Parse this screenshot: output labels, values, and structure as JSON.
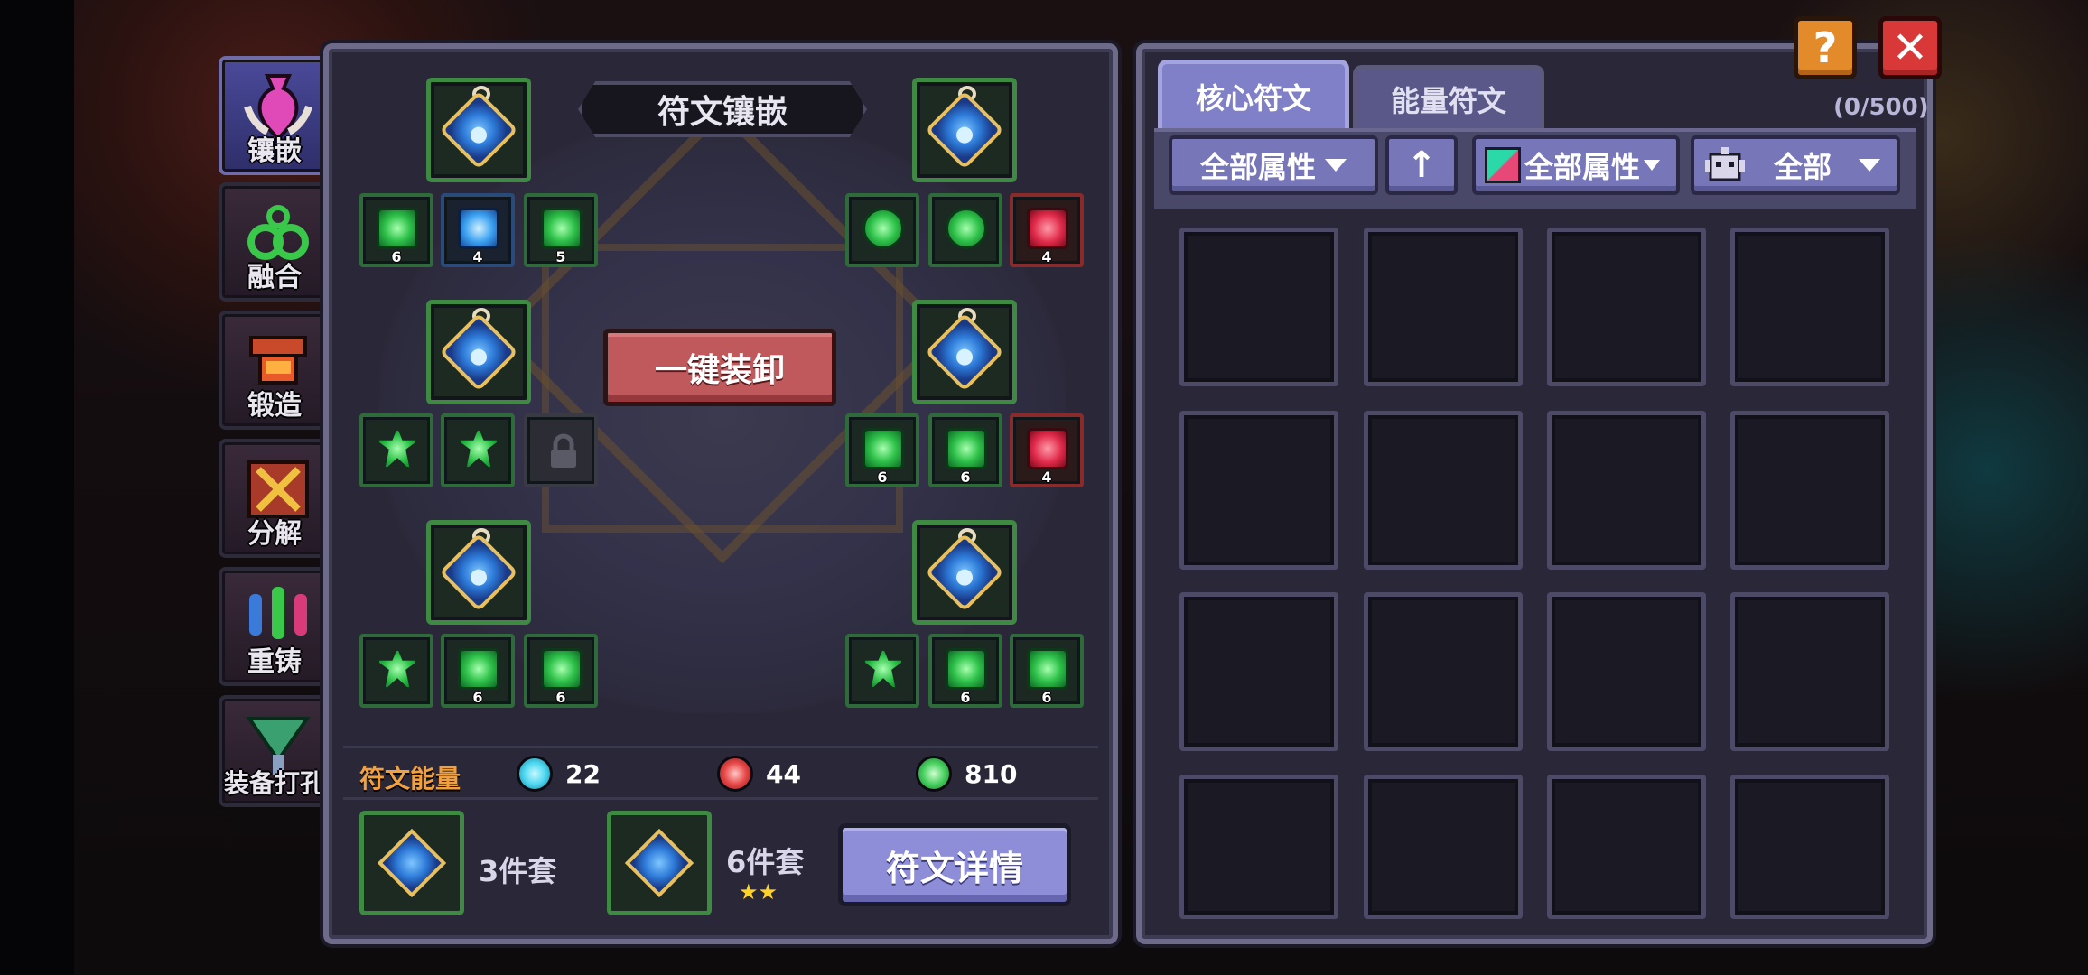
{
  "nav": {
    "items": [
      {
        "label": "镶嵌",
        "icon": "vase-icon",
        "active": true
      },
      {
        "label": "融合",
        "icon": "fusion-icon",
        "active": false
      },
      {
        "label": "锻造",
        "icon": "anvil-icon",
        "active": false
      },
      {
        "label": "分解",
        "icon": "decompose-icon",
        "active": false
      },
      {
        "label": "重铸",
        "icon": "recast-icon",
        "active": false
      },
      {
        "label": "装备打孔",
        "icon": "socket-drill-icon",
        "active": false
      }
    ]
  },
  "inlay": {
    "title": "符文镶嵌",
    "unequip_label": "一键装卸",
    "groups": [
      {
        "side": "left",
        "slots": [
          {
            "level": "6",
            "color": "green"
          },
          {
            "level": "4",
            "color": "blue"
          },
          {
            "level": "5",
            "color": "green"
          }
        ]
      },
      {
        "side": "right",
        "slots": [
          {
            "level": "",
            "color": "green"
          },
          {
            "level": "",
            "color": "green"
          },
          {
            "level": "4",
            "color": "red"
          }
        ]
      },
      {
        "side": "left",
        "slots": [
          {
            "level": "",
            "color": "green"
          },
          {
            "level": "",
            "color": "green"
          },
          {
            "level": "",
            "color": "locked"
          }
        ]
      },
      {
        "side": "right",
        "slots": [
          {
            "level": "6",
            "color": "green"
          },
          {
            "level": "6",
            "color": "green"
          },
          {
            "level": "4",
            "color": "red"
          }
        ]
      },
      {
        "side": "left",
        "slots": [
          {
            "level": "",
            "color": "green"
          },
          {
            "level": "6",
            "color": "green"
          },
          {
            "level": "6",
            "color": "green"
          }
        ]
      },
      {
        "side": "right",
        "slots": [
          {
            "level": "",
            "color": "green"
          },
          {
            "level": "6",
            "color": "green"
          },
          {
            "level": "6",
            "color": "green"
          }
        ]
      }
    ]
  },
  "energy": {
    "label": "符文能量",
    "items": [
      {
        "icon": "blue-diamond-icon",
        "value": "22",
        "color": "#4cd8f0"
      },
      {
        "icon": "red-flame-icon",
        "value": "44",
        "color": "#e84848"
      },
      {
        "icon": "green-orb-icon",
        "value": "810",
        "color": "#48d060"
      }
    ]
  },
  "sets": [
    {
      "label": "3件套",
      "stars": ""
    },
    {
      "label": "6件套",
      "stars": "★★"
    }
  ],
  "detail_button": "符文详情",
  "tabs": [
    {
      "label": "核心符文",
      "active": true
    },
    {
      "label": "能量符文",
      "active": false
    }
  ],
  "inventory_count": "(0/500)",
  "filters": {
    "attribute": "全部属性",
    "sort": "↑",
    "color_attribute": "全部属性",
    "type": "全部"
  },
  "buttons": {
    "help": "?",
    "close": "✕"
  },
  "colors": {
    "accent": "#8080c8",
    "unequip": "#c0595c",
    "energy_label": "#f0a040",
    "star": "#ffd22a"
  }
}
